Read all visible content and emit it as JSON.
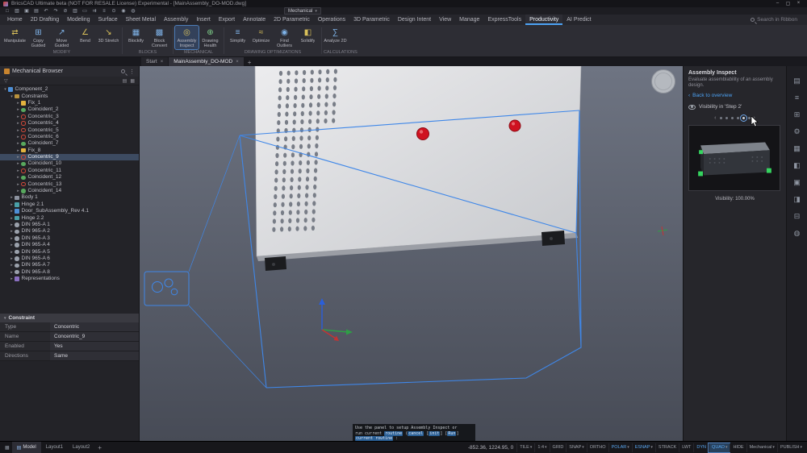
{
  "titlebar": {
    "title": "BricsCAD Ultimate beta (NOT FOR RESALE License) Experimental - [MainAssembly_DO-MOD.dwg]"
  },
  "qat": {
    "icons": [
      "new-file-icon",
      "open-file-icon",
      "save-icon",
      "print-icon",
      "undo-icon",
      "redo-icon",
      "cut-icon",
      "copy-icon",
      "paste-icon",
      "match-properties-icon",
      "layers-icon",
      "osnap-icon",
      "view-icon",
      "render-icon"
    ],
    "workspace": "Mechanical"
  },
  "menubar": {
    "items": [
      "Home",
      "2D Drafting",
      "Modeling",
      "Surface",
      "Sheet Metal",
      "Assembly",
      "Insert",
      "Export",
      "Annotate",
      "2D Parametric",
      "Operations",
      "3D Parametric",
      "Design Intent",
      "View",
      "Manage",
      "ExpressTools",
      "Productivity",
      "AI Predict"
    ],
    "active": "Productivity",
    "search_placeholder": "Search in Ribbon"
  },
  "ribbon": {
    "groups": [
      {
        "label": "MODIFY",
        "tools": [
          {
            "label": "Manipulate",
            "icon": "manipulate-icon"
          },
          {
            "label": "Copy Guided",
            "icon": "copy-guided-icon"
          },
          {
            "label": "Move Guided",
            "icon": "move-guided-icon"
          },
          {
            "label": "Bend",
            "icon": "bend-icon"
          },
          {
            "label": "3D Stretch",
            "icon": "stretch-3d-icon"
          }
        ]
      },
      {
        "label": "BLOCKS",
        "tools": [
          {
            "label": "Blockify",
            "icon": "blockify-icon"
          },
          {
            "label": "Block Convert",
            "icon": "block-convert-icon"
          }
        ]
      },
      {
        "label": "MECHANICAL",
        "tools": [
          {
            "label": "Assembly Inspect",
            "icon": "assembly-inspect-icon",
            "active": true
          },
          {
            "label": "Drawing Health",
            "icon": "drawing-health-icon"
          }
        ]
      },
      {
        "label": "DRAWING OPTIMIZATIONS",
        "tools": [
          {
            "label": "Simplify",
            "icon": "simplify-icon"
          },
          {
            "label": "Optimize",
            "icon": "optimize-icon"
          },
          {
            "label": "Find Outliers",
            "icon": "find-outliers-icon"
          },
          {
            "label": "Solidify",
            "icon": "solidify-icon"
          }
        ]
      },
      {
        "label": "CALCULATIONS",
        "tools": [
          {
            "label": "Analyze 2D",
            "icon": "analyze-2d-icon"
          }
        ]
      }
    ]
  },
  "doctabs": {
    "tabs": [
      {
        "label": "Start",
        "active": false
      },
      {
        "label": "MainAssembly_DO-MOD",
        "active": true
      }
    ],
    "add_label": "+"
  },
  "browser": {
    "title": "Mechanical Browser",
    "tree": [
      {
        "label": "Component_2",
        "depth": 0,
        "icon": "component",
        "open": true
      },
      {
        "label": "Constraints",
        "depth": 1,
        "icon": "folder",
        "open": true
      },
      {
        "label": "Fix_1",
        "depth": 2,
        "icon": "fix"
      },
      {
        "label": "Coincident_2",
        "depth": 2,
        "icon": "coincident"
      },
      {
        "label": "Concentric_3",
        "depth": 2,
        "icon": "concentric"
      },
      {
        "label": "Concentric_4",
        "depth": 2,
        "icon": "concentric"
      },
      {
        "label": "Concentric_5",
        "depth": 2,
        "icon": "concentric"
      },
      {
        "label": "Concentric_6",
        "depth": 2,
        "icon": "concentric"
      },
      {
        "label": "Coincident_7",
        "depth": 2,
        "icon": "coincident"
      },
      {
        "label": "Fix_8",
        "depth": 2,
        "icon": "fix"
      },
      {
        "label": "Concentric_9",
        "depth": 2,
        "icon": "concentric",
        "selected": true
      },
      {
        "label": "Coincident_10",
        "depth": 2,
        "icon": "coincident"
      },
      {
        "label": "Concentric_11",
        "depth": 2,
        "icon": "concentric"
      },
      {
        "label": "Coincident_12",
        "depth": 2,
        "icon": "coincident"
      },
      {
        "label": "Concentric_13",
        "depth": 2,
        "icon": "concentric"
      },
      {
        "label": "Coincident_14",
        "depth": 2,
        "icon": "coincident"
      },
      {
        "label": "Body 1",
        "depth": 1,
        "icon": "body"
      },
      {
        "label": "Hinge 2.1",
        "depth": 1,
        "icon": "hinge"
      },
      {
        "label": "Door_SubAssembly_Rev 4.1",
        "depth": 1,
        "icon": "subassembly"
      },
      {
        "label": "Hinge 2.2",
        "depth": 1,
        "icon": "hinge"
      },
      {
        "label": "DIN 965-A 1",
        "depth": 1,
        "icon": "screw"
      },
      {
        "label": "DIN 965-A 2",
        "depth": 1,
        "icon": "screw"
      },
      {
        "label": "DIN 965-A 3",
        "depth": 1,
        "icon": "screw"
      },
      {
        "label": "DIN 965-A 4",
        "depth": 1,
        "icon": "screw"
      },
      {
        "label": "DIN 965-A 5",
        "depth": 1,
        "icon": "screw"
      },
      {
        "label": "DIN 965-A 6",
        "depth": 1,
        "icon": "screw"
      },
      {
        "label": "DIN 965-A 7",
        "depth": 1,
        "icon": "screw"
      },
      {
        "label": "DIN 965-A 8",
        "depth": 1,
        "icon": "screw"
      },
      {
        "label": "Representations",
        "depth": 1,
        "icon": "representations"
      }
    ]
  },
  "properties": {
    "header": "Constraint",
    "rows": [
      {
        "label": "Type",
        "value": "Concentric"
      },
      {
        "label": "Name",
        "value": "Concentric_9"
      },
      {
        "label": "Enabled",
        "value": "Yes"
      },
      {
        "label": "Directions",
        "value": "Same"
      }
    ]
  },
  "inspect": {
    "title": "Assembly Inspect",
    "description": "Evaluate assemblability of an assembly design.",
    "back_link": "Back to overview",
    "visibility_label": "Visibility in 'Step 2'",
    "steps": 6,
    "active_step": 5,
    "visibility_value": "Visibility: 100.00%"
  },
  "side_strip": {
    "icons": [
      "properties-panel-icon",
      "layers-panel-icon",
      "structure-panel-icon",
      "mechanical-browser-panel-icon",
      "content-browser-panel-icon",
      "report-panel-icon",
      "sheet-sets-panel-icon",
      "tool-palettes-panel-icon",
      "render-composition-panel-icon",
      "assembly-inspect-panel-icon"
    ]
  },
  "command_line": {
    "lines": [
      [
        {
          "t": "Use the panel to setup Assembly Inspect or"
        }
      ],
      [
        {
          "t": "run current "
        },
        {
          "t": "routine",
          "hl": true
        },
        {
          "t": " ("
        },
        {
          "t": "cancel",
          "hl": true
        },
        {
          "t": " ["
        },
        {
          "t": "init",
          "hl": true
        },
        {
          "t": "] ["
        },
        {
          "t": "Run",
          "hl": true
        },
        {
          "t": "]"
        }
      ],
      [
        {
          "t": "current routine",
          "hl": true
        },
        {
          "t": " :"
        }
      ]
    ]
  },
  "statusbar": {
    "model_tabs": [
      {
        "label": "Model",
        "active": true
      },
      {
        "label": "Layout1",
        "active": false
      },
      {
        "label": "Layout2",
        "active": false
      }
    ],
    "add_tab": "+",
    "coords": "-852.36, 1224.95, 0",
    "toggles": [
      {
        "label": "TILE",
        "caret": true,
        "active": false
      },
      {
        "label": "1:4",
        "caret": true,
        "active": false
      },
      {
        "label": "GRID",
        "active": false
      },
      {
        "label": "SNAP",
        "caret": true,
        "active": false
      },
      {
        "label": "ORTHO",
        "active": false
      },
      {
        "label": "POLAR",
        "caret": true,
        "active": true
      },
      {
        "label": "ESNAP",
        "caret": true,
        "active": true
      },
      {
        "label": "STRACK",
        "active": false
      },
      {
        "label": "LWT",
        "active": false
      },
      {
        "label": "DYN",
        "active": true
      },
      {
        "label": "QUAD",
        "caret": true,
        "active": true,
        "boxed": true
      },
      {
        "label": "HIDE",
        "active": false
      },
      {
        "label": "Mechanical",
        "caret": true,
        "active": false
      },
      {
        "label": "PUBLISH",
        "caret": true,
        "active": false
      }
    ]
  },
  "colors": {
    "accent_blue": "#4da3f5",
    "selection_blue": "#3f87e8",
    "pin_red": "#cf1220",
    "marker_green": "#35d45f"
  }
}
